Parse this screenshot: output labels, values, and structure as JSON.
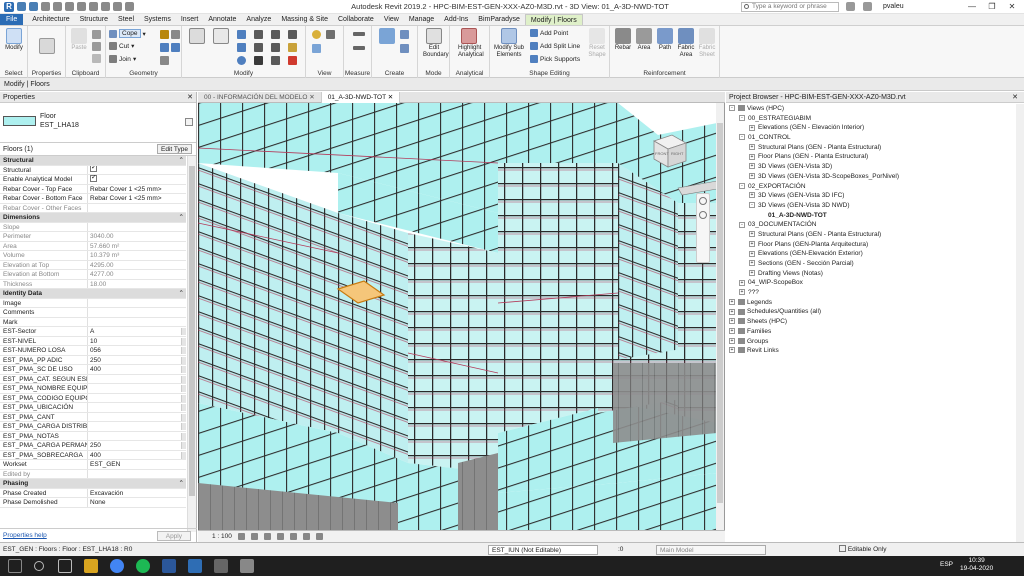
{
  "window": {
    "title": "Autodesk Revit 2019.2 - HPC-BIM-EST-GEN-XXX-AZ0-M3D.rvt - 3D View: 01_A-3D-NWD-TOT",
    "search_placeholder": "Type a keyword or phrase",
    "user": "pvaleu",
    "quick_access_icon": "R"
  },
  "ribbon_tabs": [
    "File",
    "Architecture",
    "Structure",
    "Steel",
    "Systems",
    "Insert",
    "Annotate",
    "Analyze",
    "Massing & Site",
    "Collaborate",
    "View",
    "Manage",
    "Add-Ins",
    "BimParadyse",
    "Modify | Floors"
  ],
  "ribbon": {
    "select_panel": {
      "modify": "Modify",
      "label": "Select"
    },
    "properties_panel": {
      "button": "Properties",
      "label": ""
    },
    "clipboard_panel": {
      "paste": "Paste",
      "label": "Clipboard"
    },
    "geometry_panel": {
      "cope": "Cope",
      "cut": "Cut",
      "join": "Join",
      "label": "Geometry"
    },
    "modify_panel": {
      "label": "Modify"
    },
    "view_panel": {
      "label": "View"
    },
    "measure_panel": {
      "label": "Measure"
    },
    "create_panel": {
      "label": "Create"
    },
    "mode_panel": {
      "edit_boundary": "Edit Boundary",
      "label": "Mode"
    },
    "analytical_panel": {
      "highlight": "Highlight Analytical",
      "label": "Analytical"
    },
    "shape_panel": {
      "modify_sub": "Modify Sub Elements",
      "add_point": "Add Point",
      "add_split_line": "Add Split Line",
      "pick_supports": "Pick Supports",
      "reset_shape": "Reset Shape",
      "label": "Shape Editing"
    },
    "reinforcement_panel": {
      "rebar": "Rebar",
      "area": "Area",
      "path": "Path",
      "fabric_area": "Fabric Area",
      "fabric_sheet": "Fabric Sheet",
      "label": "Reinforcement"
    }
  },
  "options_bar": "Modify | Floors",
  "properties": {
    "title": "Properties",
    "type_family": "Floor",
    "type_name": "EST_LHA18",
    "instance": "Floors (1)",
    "edit_type": "Edit Type",
    "rows": [
      {
        "k": "Structural",
        "sec": true
      },
      {
        "k": "Structural",
        "v": "",
        "chk": true
      },
      {
        "k": "Enable Analytical Model",
        "v": "",
        "chk": true
      },
      {
        "k": "Rebar Cover - Top Face",
        "v": "Rebar Cover 1 <25 mm>"
      },
      {
        "k": "Rebar Cover - Bottom Face",
        "v": "Rebar Cover 1 <25 mm>"
      },
      {
        "k": "Rebar Cover - Other Faces",
        "v": "",
        "grey": true
      },
      {
        "k": "Dimensions",
        "sec": true
      },
      {
        "k": "Slope",
        "v": "",
        "grey": true
      },
      {
        "k": "Perimeter",
        "v": "3040.00",
        "grey": true
      },
      {
        "k": "Area",
        "v": "57.660 m²",
        "grey": true
      },
      {
        "k": "Volume",
        "v": "10.379 m³",
        "grey": true
      },
      {
        "k": "Elevation at Top",
        "v": "4295.00",
        "grey": true
      },
      {
        "k": "Elevation at Bottom",
        "v": "4277.00",
        "grey": true
      },
      {
        "k": "Thickness",
        "v": "18.00",
        "grey": true
      },
      {
        "k": "Identity Data",
        "sec": true
      },
      {
        "k": "Image",
        "v": ""
      },
      {
        "k": "Comments",
        "v": ""
      },
      {
        "k": "Mark",
        "v": ""
      },
      {
        "k": "EST-Sector",
        "v": "A"
      },
      {
        "k": "EST-NIVEL",
        "v": "10"
      },
      {
        "k": "EST-NUMERO LOSA",
        "v": "056"
      },
      {
        "k": "EST_PMA_PP ADIC",
        "v": "250"
      },
      {
        "k": "EST_PMA_SC DE USO",
        "v": "400"
      },
      {
        "k": "EST_PMA_CAT. SEGUN ESP.",
        "v": ""
      },
      {
        "k": "EST_PMA_NOMBRE EQUIPO",
        "v": ""
      },
      {
        "k": "EST_PMA_CODIGO EQUIPO",
        "v": ""
      },
      {
        "k": "EST_PMA_UBICACIÓN",
        "v": ""
      },
      {
        "k": "EST_PMA_CANT",
        "v": ""
      },
      {
        "k": "EST_PMA_CARGA DISTRIB.",
        "v": ""
      },
      {
        "k": "EST_PMA_NOTAS",
        "v": ""
      },
      {
        "k": "EST_PMA_CARGA PERMANE...",
        "v": "250"
      },
      {
        "k": "EST_PMA_SOBRECARGA",
        "v": "400"
      },
      {
        "k": "Workset",
        "v": "EST_GEN"
      },
      {
        "k": "Edited by",
        "v": "",
        "grey": true
      },
      {
        "k": "Phasing",
        "sec": true
      },
      {
        "k": "Phase Created",
        "v": "Excavación"
      },
      {
        "k": "Phase Demolished",
        "v": "None"
      }
    ],
    "help_link": "Properties help",
    "apply": "Apply"
  },
  "view_tabs": [
    "00 - INFORMACIÓN DEL MODELO",
    "01_A-3D-NWD-TOT"
  ],
  "viewcube": {
    "front": "FRONT",
    "right": "RIGHT"
  },
  "view_scale": "1 : 100",
  "project_browser": {
    "title": "Project Browser - HPC-BIM-EST-GEN-XXX-AZ0-M3D.rvt",
    "items": [
      {
        "t": "Views (HPC)",
        "l": 0,
        "e": "-"
      },
      {
        "t": "00_ESTRATEGIABIM",
        "l": 1,
        "e": "-"
      },
      {
        "t": "Elevations (GEN - Elevación Interior)",
        "l": 2,
        "e": "+"
      },
      {
        "t": "01_CONTROL",
        "l": 1,
        "e": "-"
      },
      {
        "t": "Structural Plans (GEN - Planta Estructural)",
        "l": 2,
        "e": "+"
      },
      {
        "t": "Floor Plans (GEN - Planta Estructural)",
        "l": 2,
        "e": "+"
      },
      {
        "t": "3D Views (GEN-Vista 3D)",
        "l": 2,
        "e": "+"
      },
      {
        "t": "3D Views (GEN-Vista 3D-ScopeBoxes_PorNivel)",
        "l": 2,
        "e": "+"
      },
      {
        "t": "02_EXPORTACIÓN",
        "l": 1,
        "e": "-"
      },
      {
        "t": "3D Views (GEN-Vista 3D IFC)",
        "l": 2,
        "e": "+"
      },
      {
        "t": "3D Views (GEN-Vista 3D NWD)",
        "l": 2,
        "e": "-"
      },
      {
        "t": "01_A-3D-NWD-TOT",
        "l": 3,
        "e": "",
        "sel": true
      },
      {
        "t": "03_DOCUMENTACIÓN",
        "l": 1,
        "e": "-"
      },
      {
        "t": "Structural Plans (GEN - Planta Estructural)",
        "l": 2,
        "e": "+"
      },
      {
        "t": "Floor Plans (GEN-Planta Arquitectura)",
        "l": 2,
        "e": "+"
      },
      {
        "t": "Elevations (GEN-Elevación Exterior)",
        "l": 2,
        "e": "+"
      },
      {
        "t": "Sections (GEN - Sección Parcial)",
        "l": 2,
        "e": "+"
      },
      {
        "t": "Drafting Views (Notas)",
        "l": 2,
        "e": "+"
      },
      {
        "t": "04_WIP-ScopeBox",
        "l": 1,
        "e": "+"
      },
      {
        "t": "???",
        "l": 1,
        "e": "+"
      },
      {
        "t": "Legends",
        "l": 0,
        "e": "+"
      },
      {
        "t": "Schedules/Quantities (all)",
        "l": 0,
        "e": "+"
      },
      {
        "t": "Sheets (HPC)",
        "l": 0,
        "e": "+"
      },
      {
        "t": "Families",
        "l": 0,
        "e": "+"
      },
      {
        "t": "Groups",
        "l": 0,
        "e": "+"
      },
      {
        "t": "Revit Links",
        "l": 0,
        "e": "+"
      }
    ]
  },
  "status_bar": {
    "selection": "EST_GEN : Floors : Floor : EST_LHA18 : R0",
    "workset": "EST_IUN (Not Editable)",
    "model": "Main Model",
    "editable_only": "Editable Only",
    "scale_readout": ":0"
  },
  "taskbar": {
    "time": "10:39",
    "date": "19-04-2020",
    "lang": "ESP"
  },
  "colors": {
    "slab": "#aef0ef",
    "selected_slab": "#f5c67a",
    "frame": "#3a3a3a",
    "accent": "#2b6cb5"
  }
}
